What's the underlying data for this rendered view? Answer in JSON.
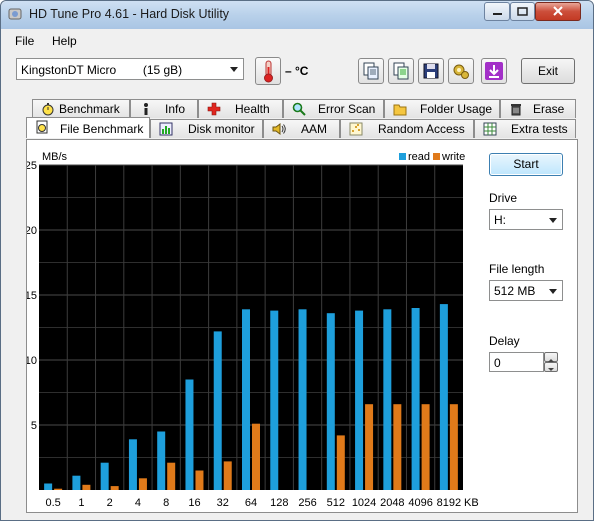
{
  "window": {
    "title": "HD Tune Pro 4.61 - Hard Disk Utility"
  },
  "menu": {
    "file": "File",
    "help": "Help"
  },
  "toolbar": {
    "drive_combo": "KingstonDT Micro        (15 gB)",
    "temperature": "– °C",
    "exit_label": "Exit"
  },
  "tabs_top": [
    {
      "label": "Benchmark"
    },
    {
      "label": "Info"
    },
    {
      "label": "Health"
    },
    {
      "label": "Error Scan"
    },
    {
      "label": "Folder Usage"
    },
    {
      "label": "Erase"
    }
  ],
  "tabs_bottom": [
    {
      "label": "File Benchmark"
    },
    {
      "label": "Disk monitor"
    },
    {
      "label": "AAM"
    },
    {
      "label": "Random Access"
    },
    {
      "label": "Extra tests"
    }
  ],
  "side": {
    "start_label": "Start",
    "drive_label": "Drive",
    "drive_value": "H:",
    "file_length_label": "File length",
    "file_length_value": "512 MB",
    "delay_label": "Delay",
    "delay_value": "0"
  },
  "chart_data": {
    "type": "bar",
    "ylabel": "MB/s",
    "xlabel": "KB",
    "ylim": [
      0,
      25
    ],
    "yticks": [
      5,
      10,
      15,
      20,
      25
    ],
    "grid": true,
    "legend_position": "top-right",
    "categories": [
      "0.5",
      "1",
      "2",
      "4",
      "8",
      "16",
      "32",
      "64",
      "128",
      "256",
      "512",
      "1024",
      "2048",
      "4096",
      "8192"
    ],
    "series": [
      {
        "name": "read",
        "color": "#1e9fdc",
        "values": [
          0.5,
          1.1,
          2.1,
          3.9,
          4.5,
          8.5,
          12.2,
          13.9,
          13.8,
          13.9,
          13.6,
          13.8,
          13.9,
          14.0,
          14.3
        ]
      },
      {
        "name": "write",
        "color": "#e07a1a",
        "values": [
          0.1,
          0.4,
          0.3,
          0.9,
          2.1,
          1.5,
          2.2,
          5.1,
          0,
          0,
          4.2,
          6.6,
          6.6,
          6.6,
          6.6
        ]
      }
    ]
  }
}
